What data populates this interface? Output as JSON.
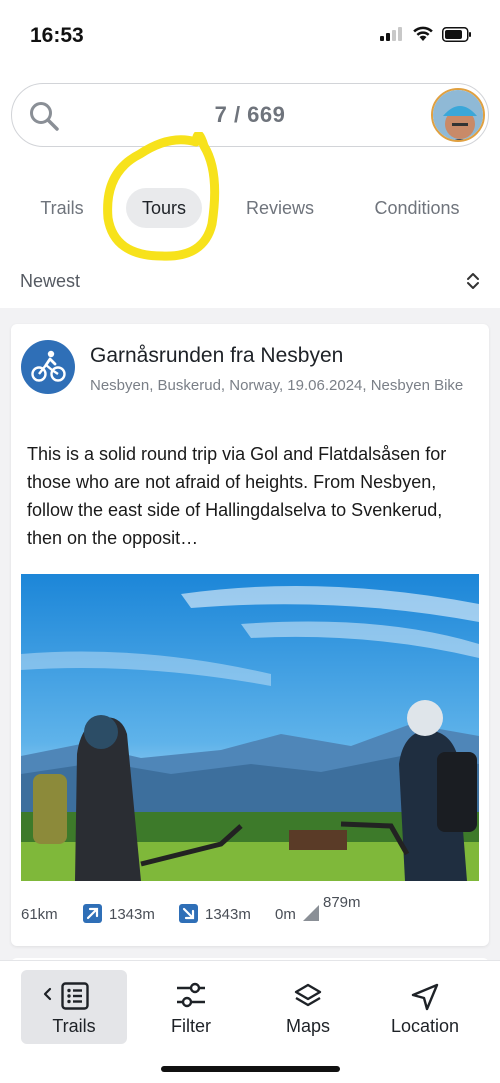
{
  "status_bar": {
    "time": "16:53",
    "icons": [
      "cellular-signal-icon",
      "wifi-icon",
      "battery-icon"
    ]
  },
  "search": {
    "result_count": "7 / 669"
  },
  "tabs": [
    {
      "label": "Trails",
      "active": false
    },
    {
      "label": "Tours",
      "active": true
    },
    {
      "label": "Reviews",
      "active": false
    },
    {
      "label": "Conditions",
      "active": false
    }
  ],
  "sort": {
    "label": "Newest"
  },
  "card": {
    "title": "Garnåsrunden fra Nesbyen",
    "meta": "Nesbyen, Buskerud, Norway, 19.06.2024, Nesbyen Bike",
    "description": "This is a solid round trip via Gol and Flatdalsåsen for those who are not afraid of heights. From Nesbyen, follow the east side of Hallingdalselva to Svenkerud, then on the opposit…",
    "stats": {
      "distance": "61km",
      "ascent": "1343m",
      "descent": "1343m",
      "min_elevation": "0m",
      "max_elevation": "879m"
    }
  },
  "bottom_nav": [
    {
      "label": "Trails",
      "active": true
    },
    {
      "label": "Filter",
      "active": false
    },
    {
      "label": "Maps",
      "active": false
    },
    {
      "label": "Location",
      "active": false
    }
  ],
  "colors": {
    "accent_blue": "#2f6fb7",
    "highlight_yellow": "#f7e21b",
    "background": "#f2f2f4"
  }
}
